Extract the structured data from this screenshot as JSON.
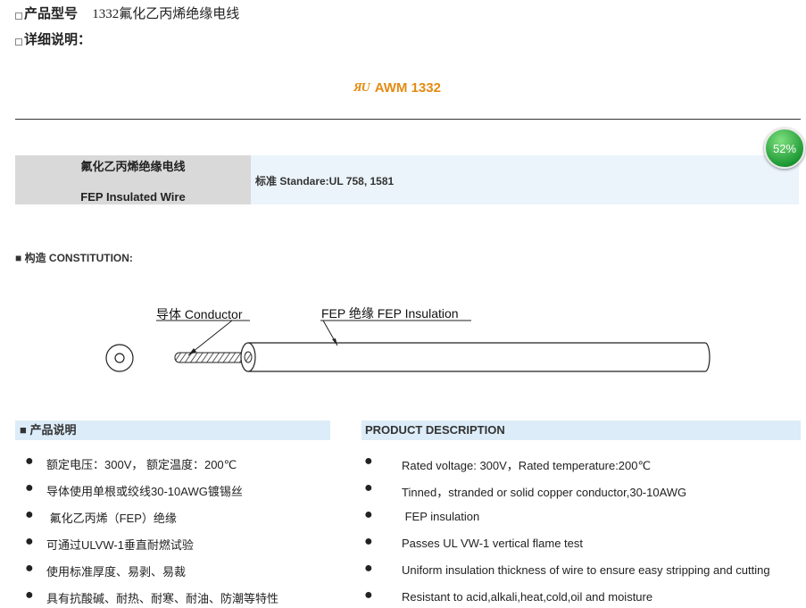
{
  "header": {
    "model_label": "产品型号",
    "model_value": "1332氟化乙丙烯绝缘电线",
    "detail_label": "详细说明："
  },
  "logo": {
    "mark": "ЯU",
    "text": "AWM 1332"
  },
  "badge": {
    "percent": "52%"
  },
  "spec": {
    "name_cn": "氟化乙丙烯绝缘电线",
    "name_en": "FEP Insulated Wire",
    "standard": "标准  Standare:UL 758, 1581"
  },
  "construction": {
    "heading": "■ 构造  CONSTITUTION:",
    "label_conductor": "导体 Conductor",
    "label_insulation": "FEP 绝缘 FEP Insulation"
  },
  "desc_cn": {
    "heading": "■ 产品说明",
    "items": [
      "额定电压：300V， 额定温度：200℃",
      "导体使用单根或绞线30-10AWG镀锡丝",
      " 氟化乙丙烯（FEP）绝缘",
      "可通过ULVW-1垂直耐燃试验",
      "使用标准厚度、易剥、易裁",
      "具有抗酸碱、耐热、耐寒、耐油、防潮等特性"
    ]
  },
  "desc_en": {
    "heading": "PRODUCT DESCRIPTION",
    "items": [
      "Rated voltage: 300V，Rated temperature:200℃",
      "Tinned，stranded or solid copper conductor,30-10AWG",
      " FEP insulation",
      "Passes UL VW-1 vertical flame test",
      "Uniform insulation thickness of wire to ensure easy stripping and cutting",
      "Resistant to acid,alkali,heat,cold,oil and moisture"
    ]
  }
}
